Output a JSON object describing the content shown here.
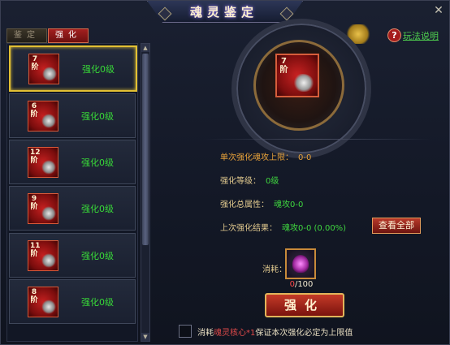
{
  "window": {
    "title": "魂灵鉴定",
    "close_glyph": "✕"
  },
  "tabs": [
    {
      "label": "鉴定",
      "active": false
    },
    {
      "label": "强化",
      "active": true
    }
  ],
  "help": {
    "icon": "question-icon",
    "glyph": "?",
    "label": "玩法说明"
  },
  "list": {
    "items": [
      {
        "stage_num": "7",
        "stage_unit": "阶",
        "label": "强化0级",
        "selected": true
      },
      {
        "stage_num": "6",
        "stage_unit": "阶",
        "label": "强化0级",
        "selected": false
      },
      {
        "stage_num": "12",
        "stage_unit": "阶",
        "label": "强化0级",
        "selected": false
      },
      {
        "stage_num": "9",
        "stage_unit": "阶",
        "label": "强化0级",
        "selected": false
      },
      {
        "stage_num": "11",
        "stage_unit": "阶",
        "label": "强化0级",
        "selected": false
      },
      {
        "stage_num": "8",
        "stage_unit": "阶",
        "label": "强化0级",
        "selected": false
      }
    ]
  },
  "selected": {
    "stage_num": "7",
    "stage_unit": "阶"
  },
  "stats": {
    "single_cap_label": "单次强化魂攻上限：",
    "single_cap_value": "0-0",
    "level_label": "强化等级：",
    "level_value": "0级",
    "total_label": "强化总属性：",
    "total_value": "魂攻0-0",
    "last_label": "上次强化结果：",
    "last_value": "魂攻0-0 (0.00%)"
  },
  "view_all_label": "查看全部",
  "consume": {
    "label": "消耗：",
    "have": "0",
    "need": "/100"
  },
  "enhance_label": "强化",
  "note": {
    "prefix": "消耗",
    "highlight": "魂灵核心*1",
    "suffix": "保证本次强化必定为上限值"
  },
  "colors": {
    "accent_green": "#3fd63f",
    "accent_gold": "#e2c033",
    "button_red": "#b83a2a"
  }
}
